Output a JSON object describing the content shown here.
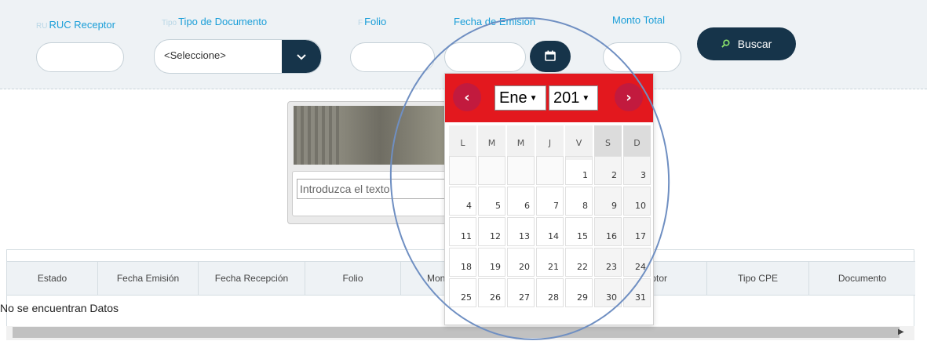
{
  "filters": {
    "ruc_label": "RUC Receptor",
    "ruc_ghost": "RU",
    "tipo_label": "Tipo de Documento",
    "tipo_ghost": "Tipo",
    "tipo_value": "<Seleccione>",
    "folio_label": "Folio",
    "folio_ghost": "F",
    "fecha_label": "Fecha de Emisión",
    "monto_label": "Monto Total",
    "search_label": "Buscar",
    "search_icon": "search-icon",
    "calendar_icon": "calendar-icon",
    "dropdown_icon": "chevron-down-icon"
  },
  "captcha": {
    "placeholder": "Introduzca el texto"
  },
  "datepicker": {
    "month": "Ene",
    "year": "201",
    "prev_icon": "chevron-left-icon",
    "next_icon": "chevron-right-icon",
    "weekdays": [
      "L",
      "M",
      "M",
      "J",
      "V",
      "S",
      "D"
    ],
    "days": [
      "",
      "",
      "",
      "",
      "1",
      "2",
      "3",
      "4",
      "5",
      "6",
      "7",
      "8",
      "9",
      "10",
      "11",
      "12",
      "13",
      "14",
      "15",
      "16",
      "17",
      "18",
      "19",
      "20",
      "21",
      "22",
      "23",
      "24",
      "25",
      "26",
      "27",
      "28",
      "29",
      "30",
      "31"
    ]
  },
  "table": {
    "headers": [
      "Estado",
      "Fecha Emisión",
      "Fecha Recepción",
      "Folio",
      "Mon",
      "Receptor",
      "Tipo CPE",
      "Documento"
    ],
    "empty_message": "No se encuentran Datos"
  },
  "colors": {
    "primary": "#16344a",
    "label": "#1a9ed8",
    "datepicker_header": "#e3181e",
    "annotation": "#6f8fc2"
  }
}
